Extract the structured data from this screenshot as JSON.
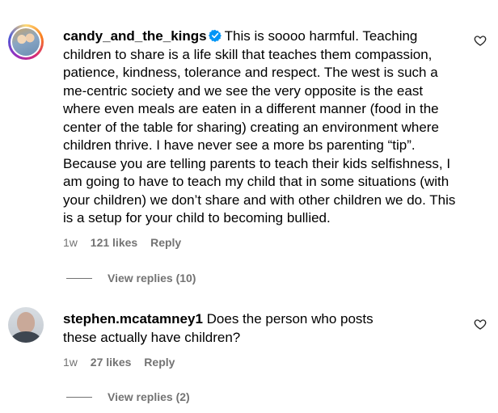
{
  "comments": [
    {
      "username": "candy_and_the_kings",
      "verified": true,
      "text": "This is soooo harmful. Teaching children to share is a life skill that teaches them compassion, patience, kindness, tolerance and respect. The west is such a me-centric society and we see the very opposite is the east where even meals are eaten in a different manner (food in the center of the table for sharing) creating an environment where children thrive. I have never see a more bs parenting “tip”. Because you are telling parents to teach their kids selfishness, I am going to have to teach my child that in some situations (with your children) we don’t share and with other children we do. This is a setup for your child to becoming bullied.",
      "time": "1w",
      "likes": "121 likes",
      "reply": "Reply",
      "view_replies": "View replies (10)",
      "avatar_icon": "story-ring-avatar"
    },
    {
      "username": "stephen.mcatamney1",
      "verified": false,
      "text": "Does the person who posts these actually have children?",
      "time": "1w",
      "likes": "27 likes",
      "reply": "Reply",
      "view_replies": "View replies (2)",
      "avatar_icon": "profile-avatar"
    }
  ],
  "icons": {
    "verified": "verified-badge-icon",
    "like": "heart-icon"
  },
  "colors": {
    "text": "#000000",
    "secondary": "#737373",
    "verified": "#0095f6"
  }
}
